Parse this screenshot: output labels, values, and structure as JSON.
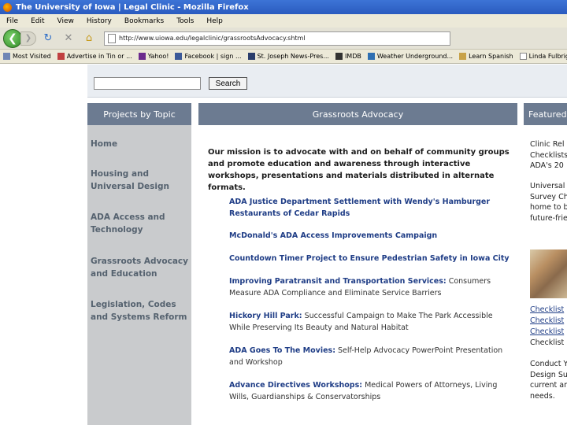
{
  "browser": {
    "window_title": "The University of Iowa | Legal Clinic - Mozilla Firefox",
    "menu": [
      "File",
      "Edit",
      "View",
      "History",
      "Bookmarks",
      "Tools",
      "Help"
    ],
    "url": "http://www.uiowa.edu/legalclinic/grassrootsAdvocacy.shtml",
    "bookmarks": [
      "Most Visited",
      "Advertise in Tin or ...",
      "Yahoo!",
      "Facebook | sign ...",
      "St. Joseph News-Pres...",
      "IMDB",
      "Weather Underground...",
      "Learn Spanish",
      "Linda Fulbright Ensem..."
    ]
  },
  "search": {
    "placeholder": "",
    "button_label": "Search"
  },
  "sidebar": {
    "heading": "Projects by Topic",
    "items": [
      {
        "label": "Home"
      },
      {
        "label": "Housing and Universal Design"
      },
      {
        "label": "ADA Access and Technology"
      },
      {
        "label": "Grassroots Advocacy and Education"
      },
      {
        "label": "Legislation, Codes and Systems Reform"
      }
    ]
  },
  "main": {
    "heading": "Grassroots Advocacy",
    "mission": "Our mission is to advocate with and on behalf of community groups and promote education and awareness through interactive workshops, presentations and materials distributed in alternate formats.",
    "projects": [
      {
        "title": "ADA Justice Department Settlement with Wendy's Hamburger Restaurants of Cedar Rapids",
        "desc": ""
      },
      {
        "title": "McDonald's ADA Access Improvements Campaign",
        "desc": ""
      },
      {
        "title": "Countdown Timer Project to Ensure Pedestrian Safety in Iowa City",
        "desc": ""
      },
      {
        "title": "Improving Paratransit and Transportation Services:",
        "desc": " Consumers Measure ADA Compliance and Eliminate Service Barriers"
      },
      {
        "title": "Hickory Hill Park:",
        "desc": " Successful Campaign to Make The Park Accessible While Preserving Its Beauty and Natural Habitat"
      },
      {
        "title": "ADA Goes To The Movies:",
        "desc": " Self-Help Advocacy PowerPoint Presentation and Workshop"
      },
      {
        "title": "Advance Directives Workshops:",
        "desc": " Medical Powers of Attorneys, Living Wills, Guardianships & Conservatorships"
      }
    ]
  },
  "featured": {
    "heading": "Featured",
    "block1": [
      "Clinic Rel",
      "Checklists",
      "ADA's 20"
    ],
    "block2": [
      "Universal",
      "Survey Ch",
      "home to b",
      "future-frie"
    ],
    "links": [
      "Checklist",
      "Checklist",
      "Checklist",
      "Checklist"
    ],
    "block3": [
      "Conduct Y",
      "Design Su",
      "current an",
      "needs."
    ]
  }
}
